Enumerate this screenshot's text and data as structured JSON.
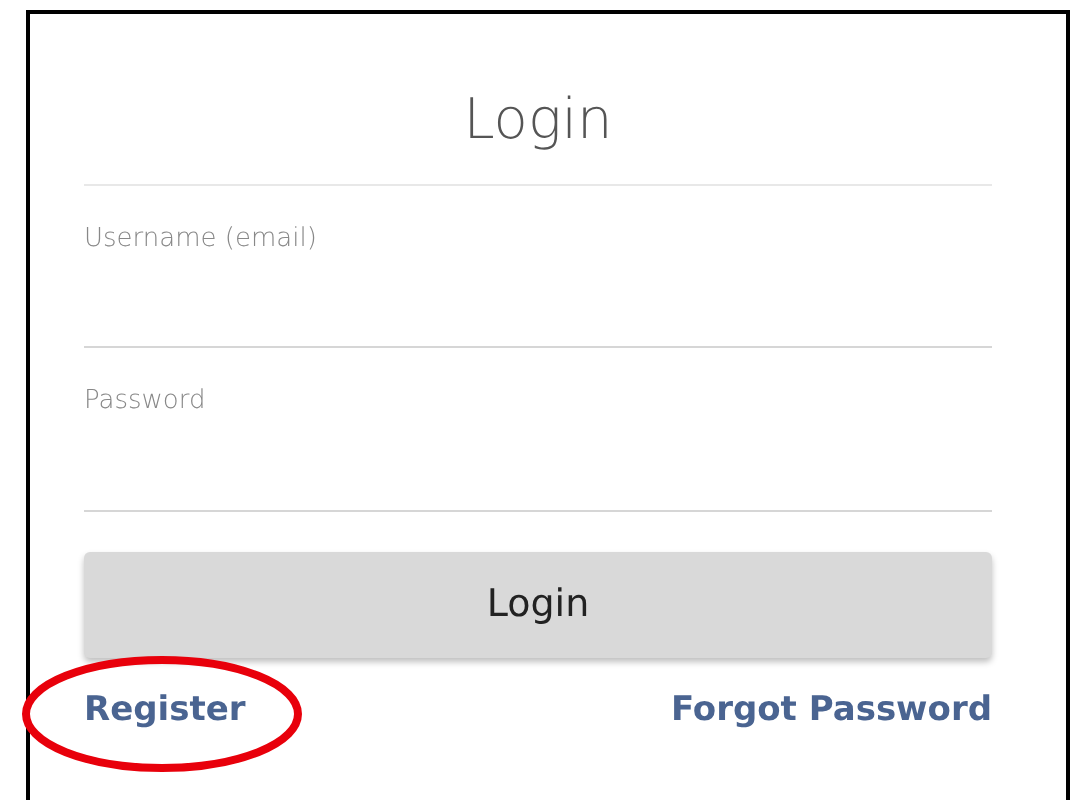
{
  "title": "Login",
  "fields": [
    {
      "label": "Username (email)"
    },
    {
      "label": "Password"
    }
  ],
  "submit_button": "Login",
  "links": [
    {
      "label": "Register",
      "circled": true
    },
    {
      "label": "Forgot Password",
      "circled": false
    }
  ]
}
